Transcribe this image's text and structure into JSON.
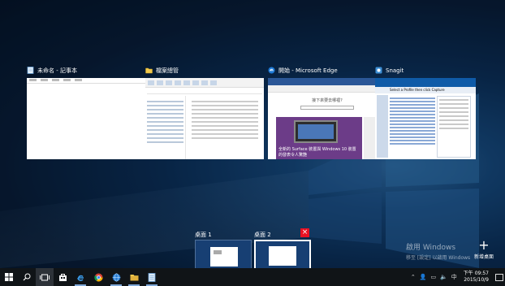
{
  "windows": [
    {
      "title": "未命名 - 記事本",
      "app": "notepad"
    },
    {
      "title": "檔案總管",
      "app": "explorer"
    },
    {
      "title": "開始 - Microsoft Edge",
      "app": "edge",
      "content": {
        "search_label": "接下來要去哪裡?",
        "news_text": "全新的 Surface 裝置與 Windows 10 裝置的發表令人驚艷"
      }
    },
    {
      "title": "Snagit",
      "app": "snagit",
      "content": {
        "header": "Select a Profile then click Capture"
      }
    }
  ],
  "desktops": [
    {
      "label": "桌面 1",
      "active": false
    },
    {
      "label": "桌面 2",
      "active": true
    }
  ],
  "new_desktop_label": "新增桌面",
  "activation": {
    "line1": "啟用 Windows",
    "line2": "移至 [設定] 以啟用 Windows"
  },
  "taskbar": {
    "icons": [
      "start-icon",
      "search-icon",
      "task-view-icon",
      "store-icon",
      "edge-icon",
      "chrome-icon",
      "globe-icon",
      "file-explorer-icon",
      "notepad-icon"
    ],
    "clock_time": "下午 09:57",
    "clock_date": "2015/10/9",
    "tray_text": "中"
  }
}
